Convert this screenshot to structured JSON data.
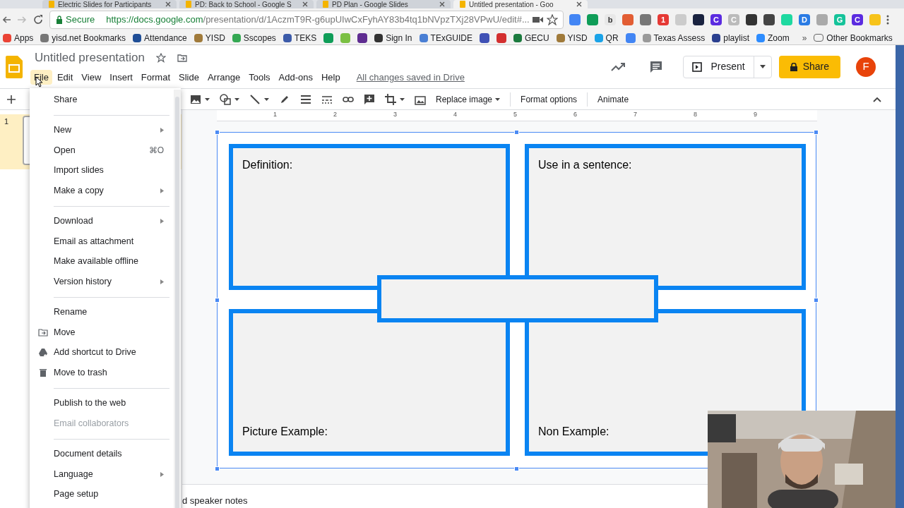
{
  "browser": {
    "tabs": [
      {
        "title": "Electric Slides for Participants",
        "selected": false
      },
      {
        "title": "PD: Back to School - Google S",
        "selected": false
      },
      {
        "title": "PD Plan - Google Slides",
        "selected": false
      },
      {
        "title": "Untitled presentation - Goo",
        "selected": true
      }
    ],
    "secure_label": "Secure",
    "url_host": "https://docs.google.com",
    "url_path": "/presentation/d/1AczmT9R-g6upUIwCxFyhAY83b4tq1bNVpzTXj28VPwU/edit#...",
    "extensions": [
      {
        "color": "#4285f4"
      },
      {
        "color": "#0f9d58"
      },
      {
        "color": "#e8e8e8",
        "letter": "b"
      },
      {
        "color": "#e25d33"
      },
      {
        "color": "#777777"
      },
      {
        "color": "#e53935",
        "letter": "1"
      },
      {
        "color": "#cccccc"
      },
      {
        "color": "#1a2340"
      },
      {
        "color": "#5b2be0",
        "letter": "C"
      },
      {
        "color": "#bbbbbb",
        "letter": "C"
      },
      {
        "color": "#333333"
      },
      {
        "color": "#444444"
      },
      {
        "color": "#1ed9a0"
      },
      {
        "color": "#2a7be4",
        "letter": "D"
      },
      {
        "color": "#aaaaaa"
      },
      {
        "color": "#15c39a",
        "letter": "G"
      },
      {
        "color": "#5b2be0",
        "letter": "C"
      },
      {
        "color": "#f7c31a"
      }
    ],
    "bookmarks": [
      {
        "label": "Apps",
        "color": "#ea4335"
      },
      {
        "label": "yisd.net Bookmarks",
        "color": "#777777"
      },
      {
        "label": "Attendance",
        "color": "#1f4e96"
      },
      {
        "label": "YISD",
        "color": "#a07a3a"
      },
      {
        "label": "Sscopes",
        "color": "#34a853"
      },
      {
        "label": "TEKS",
        "color": "#3c5ba9"
      },
      {
        "color": "#0f9d58"
      },
      {
        "color": "#7bc043"
      },
      {
        "color": "#5f2d91"
      },
      {
        "label": "Sign In",
        "color": "#333333"
      },
      {
        "label": "TExGUIDE",
        "color": "#4a7fd4"
      },
      {
        "color": "#3f51b5"
      },
      {
        "color": "#d32f2f"
      },
      {
        "label": "GECU",
        "color": "#1b7a3e"
      },
      {
        "label": "YISD",
        "color": "#a07a3a"
      },
      {
        "label": "QR",
        "color": "#1aa3e8"
      },
      {
        "color": "#4285f4"
      },
      {
        "label": "Texas Assess",
        "color": "#999999"
      },
      {
        "label": "playlist",
        "color": "#2a3f8f"
      },
      {
        "label": "Zoom",
        "color": "#2d8cff"
      }
    ],
    "more": "»",
    "other_bookmarks": "Other Bookmarks"
  },
  "app": {
    "title": "Untitled presentation",
    "menus": [
      {
        "label": "File",
        "selected": true
      },
      {
        "label": "Edit",
        "selected": false
      },
      {
        "label": "View",
        "selected": false
      },
      {
        "label": "Insert",
        "selected": false
      },
      {
        "label": "Format",
        "selected": false
      },
      {
        "label": "Slide",
        "selected": false
      },
      {
        "label": "Arrange",
        "selected": false
      },
      {
        "label": "Tools",
        "selected": false
      },
      {
        "label": "Add-ons",
        "selected": false
      },
      {
        "label": "Help",
        "selected": false
      }
    ],
    "save_status": "All changes saved in Drive",
    "present": "Present",
    "share": "Share",
    "avatar": "F"
  },
  "toolbar": {
    "replace_image": "Replace image",
    "format_options": "Format options",
    "animate": "Animate"
  },
  "ruler": [
    "1",
    "2",
    "3",
    "4",
    "5",
    "6",
    "7",
    "8",
    "9"
  ],
  "filmstrip": [
    {
      "number": "1",
      "selected": true
    }
  ],
  "slide": {
    "boxes": [
      {
        "label": "Definition:"
      },
      {
        "label": "Use in a sentence:"
      },
      {
        "label": "Picture Example:"
      },
      {
        "label": "Non Example:"
      }
    ]
  },
  "speaker_notes": "d speaker notes",
  "file_menu": [
    {
      "kind": "item",
      "label": "Share"
    },
    {
      "kind": "separator"
    },
    {
      "kind": "item",
      "label": "New",
      "submenu": true
    },
    {
      "kind": "item",
      "label": "Open",
      "shortcut": "⌘O"
    },
    {
      "kind": "item",
      "label": "Import slides"
    },
    {
      "kind": "item",
      "label": "Make a copy",
      "submenu": true
    },
    {
      "kind": "separator"
    },
    {
      "kind": "item",
      "label": "Download",
      "submenu": true
    },
    {
      "kind": "item",
      "label": "Email as attachment"
    },
    {
      "kind": "item",
      "label": "Make available offline"
    },
    {
      "kind": "item",
      "label": "Version history",
      "submenu": true
    },
    {
      "kind": "separator"
    },
    {
      "kind": "item",
      "label": "Rename"
    },
    {
      "kind": "folder_item",
      "label": "Move"
    },
    {
      "kind": "drive_item",
      "label": "Add shortcut to Drive"
    },
    {
      "kind": "trash_item",
      "label": "Move to trash"
    },
    {
      "kind": "separator"
    },
    {
      "kind": "item",
      "label": "Publish to the web"
    },
    {
      "kind": "item",
      "label": "Email collaborators",
      "disabled": true
    },
    {
      "kind": "separator"
    },
    {
      "kind": "item",
      "label": "Document details"
    },
    {
      "kind": "item",
      "label": "Language",
      "submenu": true
    },
    {
      "kind": "item",
      "label": "Page setup"
    }
  ],
  "webcam": {
    "kind": "picture"
  }
}
